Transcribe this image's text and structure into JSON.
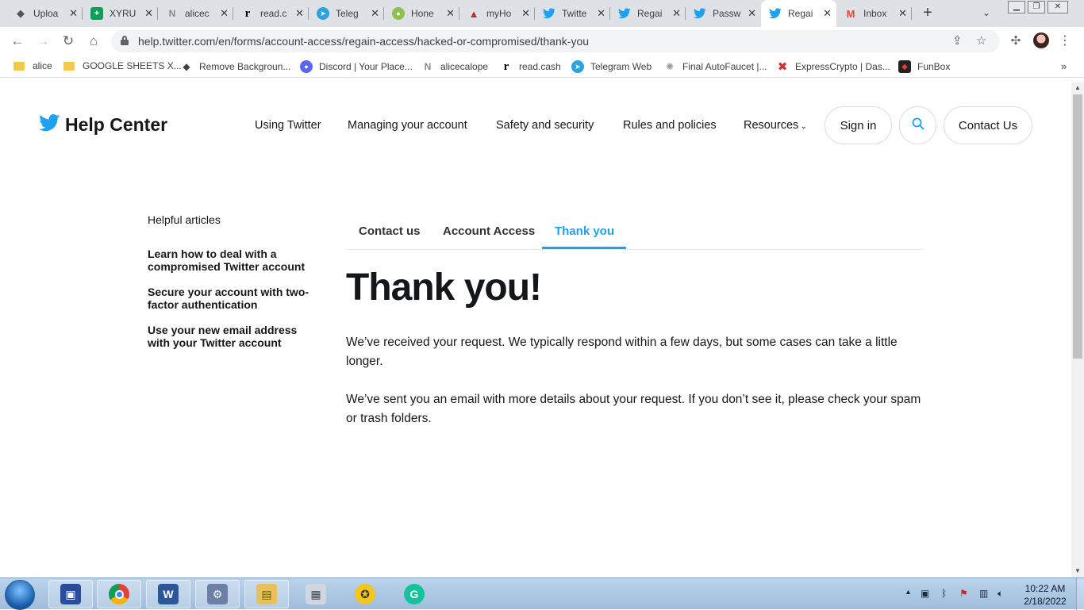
{
  "browser": {
    "tabs": [
      {
        "label": "Uploa",
        "icon": "graduation-cap-icon"
      },
      {
        "label": "XYRU",
        "icon": "sheets-icon"
      },
      {
        "label": "alicec",
        "icon": "noise-icon"
      },
      {
        "label": "read.c",
        "icon": "readcash-icon"
      },
      {
        "label": "Teleg",
        "icon": "telegram-icon"
      },
      {
        "label": "Hone",
        "icon": "honeygain-icon"
      },
      {
        "label": "myHo",
        "icon": "myhome-icon"
      },
      {
        "label": "Twitte",
        "icon": "twitter-icon"
      },
      {
        "label": "Regai",
        "icon": "twitter-icon"
      },
      {
        "label": "Passw",
        "icon": "twitter-icon"
      },
      {
        "label": "Regai",
        "icon": "twitter-icon",
        "active": true
      },
      {
        "label": "Inbox",
        "icon": "gmail-icon"
      }
    ],
    "url": "help.twitter.com/en/forms/account-access/regain-access/hacked-or-compromised/thank-you",
    "bookmarks": [
      {
        "label": "alice",
        "icon": "folder-icon"
      },
      {
        "label": "GOOGLE SHEETS X...",
        "icon": "folder-icon"
      },
      {
        "label": "Remove Backgroun...",
        "icon": "removebg-icon"
      },
      {
        "label": "Discord | Your Place...",
        "icon": "discord-icon"
      },
      {
        "label": "alicecalope",
        "icon": "noise-icon"
      },
      {
        "label": "read.cash",
        "icon": "readcash-icon"
      },
      {
        "label": "Telegram Web",
        "icon": "telegram-icon"
      },
      {
        "label": "Final AutoFaucet |...",
        "icon": "faucet-icon"
      },
      {
        "label": "ExpressCrypto | Das...",
        "icon": "expresscrypto-icon"
      },
      {
        "label": "FunBox",
        "icon": "funbox-icon"
      }
    ],
    "colors": {
      "tabstrip": "#dee1e6",
      "twitter_blue": "#1da1f2"
    }
  },
  "header": {
    "logo_text": "Help Center",
    "nav": [
      "Using Twitter",
      "Managing your account",
      "Safety and security",
      "Rules and policies",
      "Resources"
    ],
    "sign_in": "Sign in",
    "contact": "Contact Us"
  },
  "sidebar": {
    "heading": "Helpful articles",
    "links": [
      "Learn how to deal with a compromised Twitter account",
      "Secure your account with two-factor authentication",
      "Use your new email address with your Twitter account"
    ]
  },
  "form_tabs": {
    "items": [
      "Contact us",
      "Account Access",
      "Thank you"
    ],
    "active_index": 2
  },
  "content": {
    "title": "Thank you!",
    "para1": "We’ve received your request. We typically respond within a few days, but some cases can take a little longer.",
    "para2": "We’ve sent you an email with more details about your request. If you don’t see it, please check your spam or trash folders."
  },
  "taskbar": {
    "apps": [
      "desktop-manager-icon",
      "chrome-icon",
      "word-icon",
      "network-tool-icon",
      "file-explorer-icon",
      "calculator-icon",
      "emblem-icon",
      "grammarly-icon"
    ],
    "time": "10:22 AM",
    "date": "2/18/2022"
  }
}
